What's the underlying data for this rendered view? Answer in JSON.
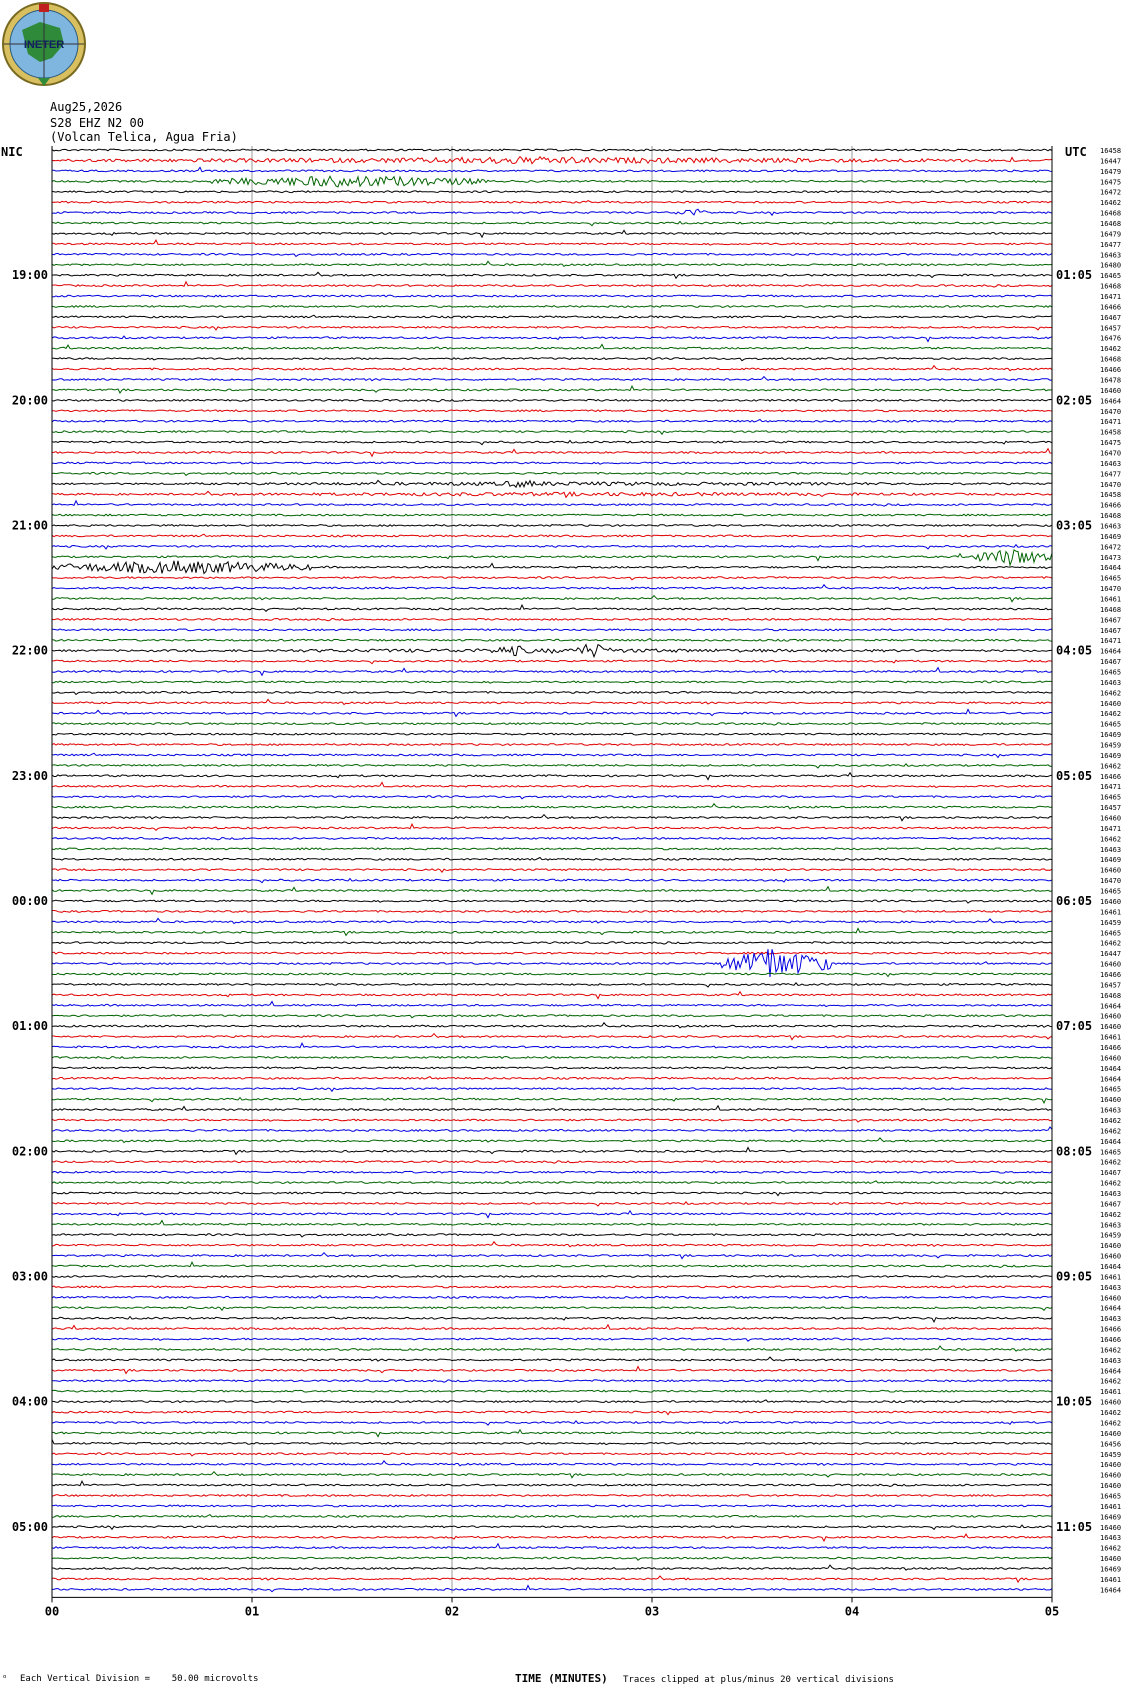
{
  "header": {
    "logo_text": "INETER",
    "date": "Aug25,2026",
    "channel": "S28 EHZ N2 00",
    "station": "(Volcan Telica, Agua Fria)",
    "left_tz": "NIC",
    "right_tz": "UTC"
  },
  "footer": {
    "scale_note": "Each Vertical Division =    50.00 microvolts",
    "clip_note": "Traces clipped at plus/minus 20 vertical divisions",
    "mark": "ᵒ"
  },
  "colors": {
    "trace_cycle": [
      "#000000",
      "#e00000",
      "#0000e0",
      "#006400"
    ],
    "grid": "#999999"
  },
  "chart_data": {
    "type": "line",
    "title": "",
    "xlabel": "TIME (MINUTES)",
    "ylabel": "",
    "xlim": [
      0,
      5
    ],
    "x_ticks": [
      "00",
      "01",
      "02",
      "03",
      "04",
      "05"
    ],
    "left_labels": [
      {
        "row": 12,
        "text": "19:00"
      },
      {
        "row": 24,
        "text": "20:00"
      },
      {
        "row": 36,
        "text": "21:00"
      },
      {
        "row": 48,
        "text": "22:00"
      },
      {
        "row": 60,
        "text": "23:00"
      },
      {
        "row": 72,
        "text": "00:00"
      },
      {
        "row": 84,
        "text": "01:00"
      },
      {
        "row": 96,
        "text": "02:00"
      },
      {
        "row": 108,
        "text": "03:00"
      },
      {
        "row": 120,
        "text": "04:00"
      },
      {
        "row": 132,
        "text": "05:00"
      }
    ],
    "right_labels": [
      {
        "row": 12,
        "text": "01:05"
      },
      {
        "row": 24,
        "text": "02:05"
      },
      {
        "row": 36,
        "text": "03:05"
      },
      {
        "row": 48,
        "text": "04:05"
      },
      {
        "row": 60,
        "text": "05:05"
      },
      {
        "row": 72,
        "text": "06:05"
      },
      {
        "row": 84,
        "text": "07:05"
      },
      {
        "row": 96,
        "text": "08:05"
      },
      {
        "row": 108,
        "text": "09:05"
      },
      {
        "row": 120,
        "text": "10:05"
      },
      {
        "row": 132,
        "text": "11:05"
      }
    ],
    "trace_values": [
      16458,
      16447,
      16479,
      16475,
      16472,
      16462,
      16468,
      16468,
      16479,
      16477,
      16463,
      16480,
      16465,
      16468,
      16471,
      16466,
      16467,
      16457,
      16476,
      16462,
      16468,
      16466,
      16478,
      16460,
      16464,
      16470,
      16471,
      16458,
      16475,
      16470,
      16463,
      16477,
      16470,
      16458,
      16466,
      16468,
      16463,
      16469,
      16472,
      16473,
      16464,
      16465,
      16470,
      16461,
      16468,
      16467,
      16467,
      16471,
      16464,
      16467,
      16465,
      16463,
      16462,
      16460,
      16462,
      16465,
      16469,
      16459,
      16469,
      16462,
      16466,
      16471,
      16465,
      16457,
      16460,
      16471,
      16462,
      16463,
      16469,
      16460,
      16470,
      16465,
      16460,
      16461,
      16459,
      16465,
      16462,
      16447,
      16460,
      16466,
      16457,
      16468,
      16464,
      16460,
      16460,
      16461,
      16466,
      16460,
      16464,
      16464,
      16465,
      16460,
      16463,
      16462,
      16462,
      16464,
      16465,
      16462,
      16467,
      16462,
      16463,
      16467,
      16462,
      16463,
      16459,
      16460,
      16460,
      16464,
      16461,
      16463,
      16460,
      16464,
      16463,
      16466,
      16466,
      16462,
      16463,
      16464,
      16462,
      16461,
      16460,
      16462,
      16462,
      16460,
      16456,
      16459,
      16460,
      16460,
      16460,
      16465,
      16461,
      16469,
      16460,
      16463,
      16462,
      16460,
      16469,
      16461,
      16464
    ],
    "events": [
      {
        "row": 1,
        "x0": 0.0,
        "x1": 5.0,
        "amp": 3
      },
      {
        "row": 1,
        "x0": 1.5,
        "x1": 3.2,
        "amp": 4
      },
      {
        "row": 3,
        "x0": 0.8,
        "x1": 2.2,
        "amp": 6
      },
      {
        "row": 6,
        "x0": 3.1,
        "x1": 3.3,
        "amp": 4
      },
      {
        "row": 32,
        "x0": 2.2,
        "x1": 2.5,
        "amp": 4
      },
      {
        "row": 32,
        "x0": 0.4,
        "x1": 5.0,
        "amp": 2
      },
      {
        "row": 33,
        "x0": 0.3,
        "x1": 5.0,
        "amp": 2
      },
      {
        "row": 39,
        "x0": 4.6,
        "x1": 5.0,
        "amp": 9
      },
      {
        "row": 40,
        "x0": 0.0,
        "x1": 1.3,
        "amp": 7
      },
      {
        "row": 48,
        "x0": 2.2,
        "x1": 2.4,
        "amp": 6
      },
      {
        "row": 48,
        "x0": 2.6,
        "x1": 2.8,
        "amp": 8
      },
      {
        "row": 48,
        "x0": 0.0,
        "x1": 5.0,
        "amp": 2
      },
      {
        "row": 78,
        "x0": 3.35,
        "x1": 3.9,
        "amp": 14
      },
      {
        "row": 78,
        "x0": 3.5,
        "x1": 3.65,
        "amp": 22
      }
    ]
  }
}
